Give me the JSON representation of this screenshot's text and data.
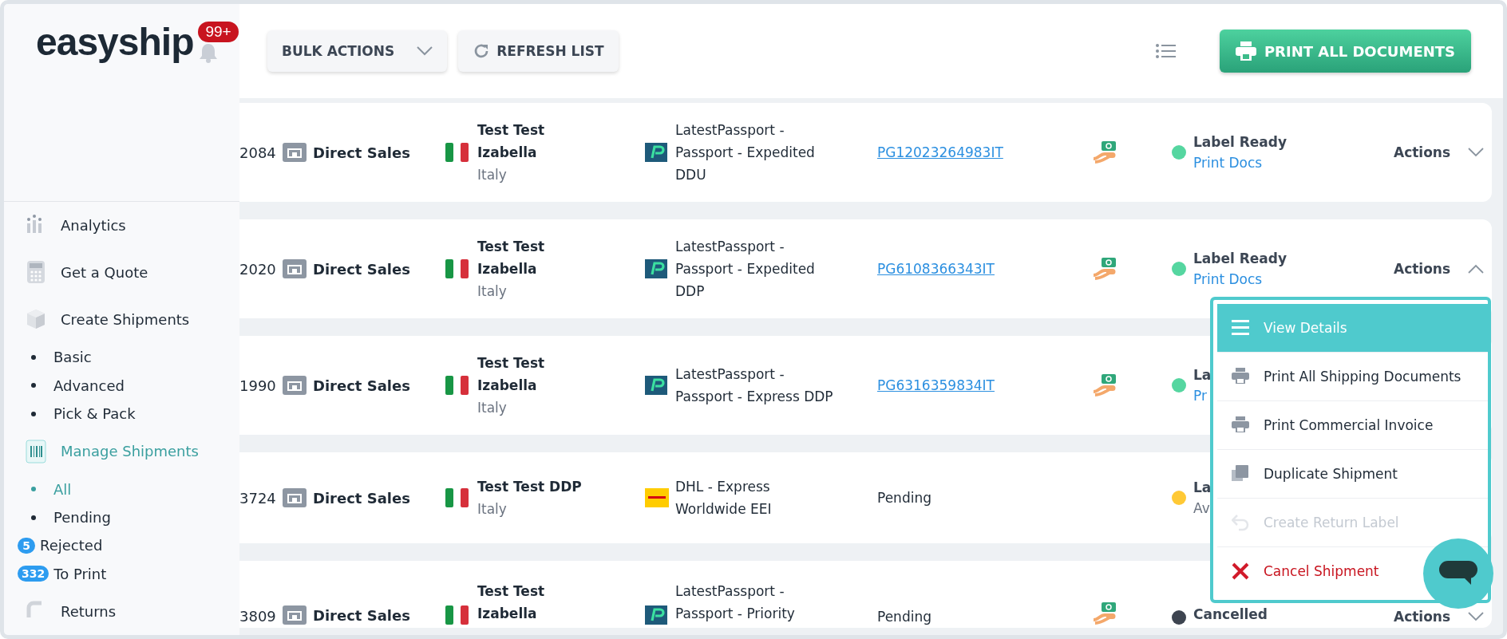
{
  "brand": {
    "name": "easyship",
    "badge": "99+"
  },
  "sidebar": {
    "items": [
      {
        "label": "Analytics",
        "kind": "main",
        "selected": false
      },
      {
        "label": "Get a Quote",
        "kind": "main",
        "selected": false
      },
      {
        "label": "Create Shipments",
        "kind": "main",
        "selected": false
      },
      {
        "label": "Basic",
        "kind": "sub",
        "selected": false
      },
      {
        "label": "Advanced",
        "kind": "sub",
        "selected": false
      },
      {
        "label": "Pick & Pack",
        "kind": "sub",
        "selected": false
      },
      {
        "label": "Manage Shipments",
        "kind": "main",
        "selected": true
      },
      {
        "label": "All",
        "kind": "sub",
        "selected": true
      },
      {
        "label": "Pending",
        "kind": "sub",
        "selected": false
      },
      {
        "label": "Rejected",
        "kind": "count",
        "count": "5",
        "selected": false
      },
      {
        "label": "To Print",
        "kind": "count",
        "count": "332",
        "selected": false
      },
      {
        "label": "Returns",
        "kind": "main",
        "selected": false
      }
    ]
  },
  "toolbar": {
    "bulk_actions": "BULK ACTIONS",
    "refresh": "REFRESH LIST",
    "print_all": "PRINT ALL DOCUMENTS"
  },
  "rows": [
    {
      "id": "2084",
      "store": "Direct Sales",
      "name": "Test Test Izabella",
      "country": "Italy",
      "courier": {
        "kind": "passport"
      },
      "service": "LatestPassport - Passport - Expedited DDU",
      "tracking": {
        "text": "PG12023264983IT",
        "kind": "link"
      },
      "payment_icon": true,
      "status": {
        "label": "Label Ready",
        "color": "#55d6a0",
        "note": {
          "text": "Print Docs",
          "kind": "link"
        }
      },
      "actions": {
        "label": "Actions",
        "expanded": false
      }
    },
    {
      "id": "2020",
      "store": "Direct Sales",
      "name": "Test Test Izabella",
      "country": "Italy",
      "courier": {
        "kind": "passport"
      },
      "service": "LatestPassport - Passport - Expedited DDP",
      "tracking": {
        "text": "PG6108366343IT",
        "kind": "link"
      },
      "payment_icon": true,
      "status": {
        "label": "Label Ready",
        "color": "#55d6a0",
        "note": {
          "text": "Print Docs",
          "kind": "link"
        }
      },
      "actions": {
        "label": "Actions",
        "expanded": true
      }
    },
    {
      "id": "1990",
      "store": "Direct Sales",
      "name": "Test Test Izabella",
      "country": "Italy",
      "courier": {
        "kind": "passport"
      },
      "service": "LatestPassport - Passport - Express DDP",
      "tracking": {
        "text": "PG6316359834IT",
        "kind": "link"
      },
      "payment_icon": true,
      "status": {
        "label": "La",
        "color": "#55d6a0",
        "note": {
          "text": "Pr",
          "kind": "link"
        }
      }
    },
    {
      "id": "3724",
      "store": "Direct Sales",
      "name": "Test Test DDP",
      "country": "Italy",
      "courier": {
        "kind": "dhl"
      },
      "service": "DHL - Express Worldwide EEI",
      "tracking": {
        "text": "Pending",
        "kind": "text"
      },
      "payment_icon": false,
      "status": {
        "label": "La",
        "color": "#ffc935",
        "note": {
          "text": "Av",
          "kind": "text"
        }
      }
    },
    {
      "id": "3809",
      "store": "Direct Sales",
      "name": "Test Test Izabella",
      "courier": {
        "kind": "passport"
      },
      "service": "LatestPassport - Passport - Priority",
      "tracking": {
        "text": "Pending",
        "kind": "text"
      },
      "payment_icon": true,
      "status": {
        "label": "Cancelled",
        "color": "#3d4450"
      },
      "actions": {
        "label": "Actions",
        "expanded": false
      }
    }
  ],
  "actions_menu": {
    "items": [
      {
        "label": "View Details",
        "kind": "details",
        "selected": true,
        "disabled": false
      },
      {
        "label": "Print All Shipping Documents",
        "kind": "print",
        "selected": false,
        "disabled": false
      },
      {
        "label": "Print Commercial Invoice",
        "kind": "print",
        "selected": false,
        "disabled": false
      },
      {
        "label": "Duplicate Shipment",
        "kind": "duplicate",
        "selected": false,
        "disabled": false
      },
      {
        "label": "Create Return Label",
        "kind": "return",
        "selected": false,
        "disabled": true
      },
      {
        "label": "Cancel Shipment",
        "kind": "cancel",
        "selected": false,
        "disabled": false
      }
    ]
  }
}
